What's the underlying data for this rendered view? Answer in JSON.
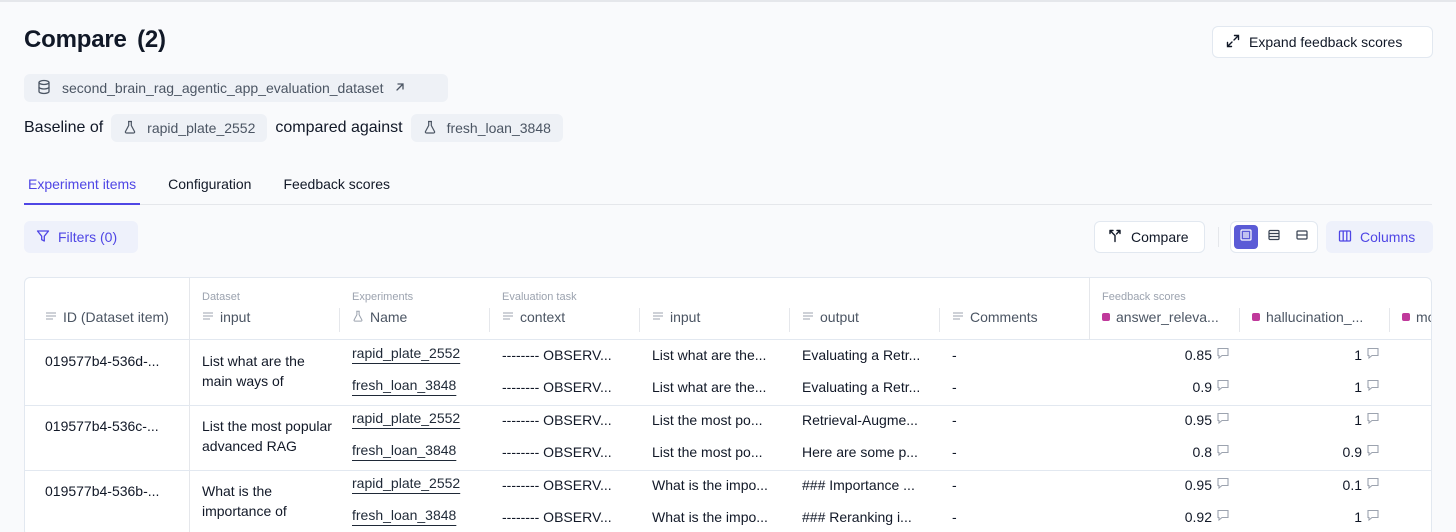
{
  "page": {
    "title": "Compare",
    "count": "(2)"
  },
  "expand_button": {
    "label": "Expand feedback scores"
  },
  "dataset": {
    "name": "second_brain_rag_agentic_app_evaluation_dataset"
  },
  "baseline": {
    "prefix": "Baseline of",
    "baseline_experiment": "rapid_plate_2552",
    "middle": "compared against",
    "compared_experiment": "fresh_loan_3848"
  },
  "tabs": [
    {
      "label": "Experiment items",
      "active": true
    },
    {
      "label": "Configuration",
      "active": false
    },
    {
      "label": "Feedback scores",
      "active": false
    }
  ],
  "toolbar": {
    "filters_label": "Filters (0)",
    "compare_label": "Compare",
    "columns_label": "Columns"
  },
  "accent_color": "#4f46e5",
  "feedback_color": "#c0399b",
  "table": {
    "headers": {
      "id": "ID (Dataset item)",
      "dataset_group": "Dataset",
      "dataset_input": "input",
      "experiments_group": "Experiments",
      "experiments_name": "Name",
      "eval_group": "Evaluation task",
      "context": "context",
      "input": "input",
      "output": "output",
      "comments": "Comments",
      "feedback_group": "Feedback scores",
      "answer_relevance": "answer_releva...",
      "hallucination": "hallucination_...",
      "moderation": "mo"
    },
    "rows": [
      {
        "id": "019577b4-536d-...",
        "input": "List what are the main ways of evaluating a RAG",
        "experiments": [
          {
            "name": "rapid_plate_2552",
            "context": "-------- OBSERV...",
            "input": "List what are the...",
            "output": "Evaluating a Retr...",
            "comments": "-",
            "answer_relevance": "0.85",
            "hallucination": "1"
          },
          {
            "name": "fresh_loan_3848",
            "context": "-------- OBSERV...",
            "input": "List what are the...",
            "output": "Evaluating a Retr...",
            "comments": "-",
            "answer_relevance": "0.9",
            "hallucination": "1"
          }
        ]
      },
      {
        "id": "019577b4-536c-...",
        "input": "List the most popular advanced RAG techniques to",
        "experiments": [
          {
            "name": "rapid_plate_2552",
            "context": "-------- OBSERV...",
            "input": "List the most po...",
            "output": "Retrieval-Augme...",
            "comments": "-",
            "answer_relevance": "0.95",
            "hallucination": "1"
          },
          {
            "name": "fresh_loan_3848",
            "context": "-------- OBSERV...",
            "input": "List the most po...",
            "output": "Here are some p...",
            "comments": "-",
            "answer_relevance": "0.8",
            "hallucination": "0.9"
          }
        ]
      },
      {
        "id": "019577b4-536b-...",
        "input": "What is the importance of reranking chunks",
        "experiments": [
          {
            "name": "rapid_plate_2552",
            "context": "-------- OBSERV...",
            "input": "What is the impo...",
            "output": "### Importance ...",
            "comments": "-",
            "answer_relevance": "0.95",
            "hallucination": "0.1"
          },
          {
            "name": "fresh_loan_3848",
            "context": "-------- OBSERV...",
            "input": "What is the impo...",
            "output": "### Reranking i...",
            "comments": "-",
            "answer_relevance": "0.92",
            "hallucination": "1"
          }
        ]
      }
    ]
  }
}
